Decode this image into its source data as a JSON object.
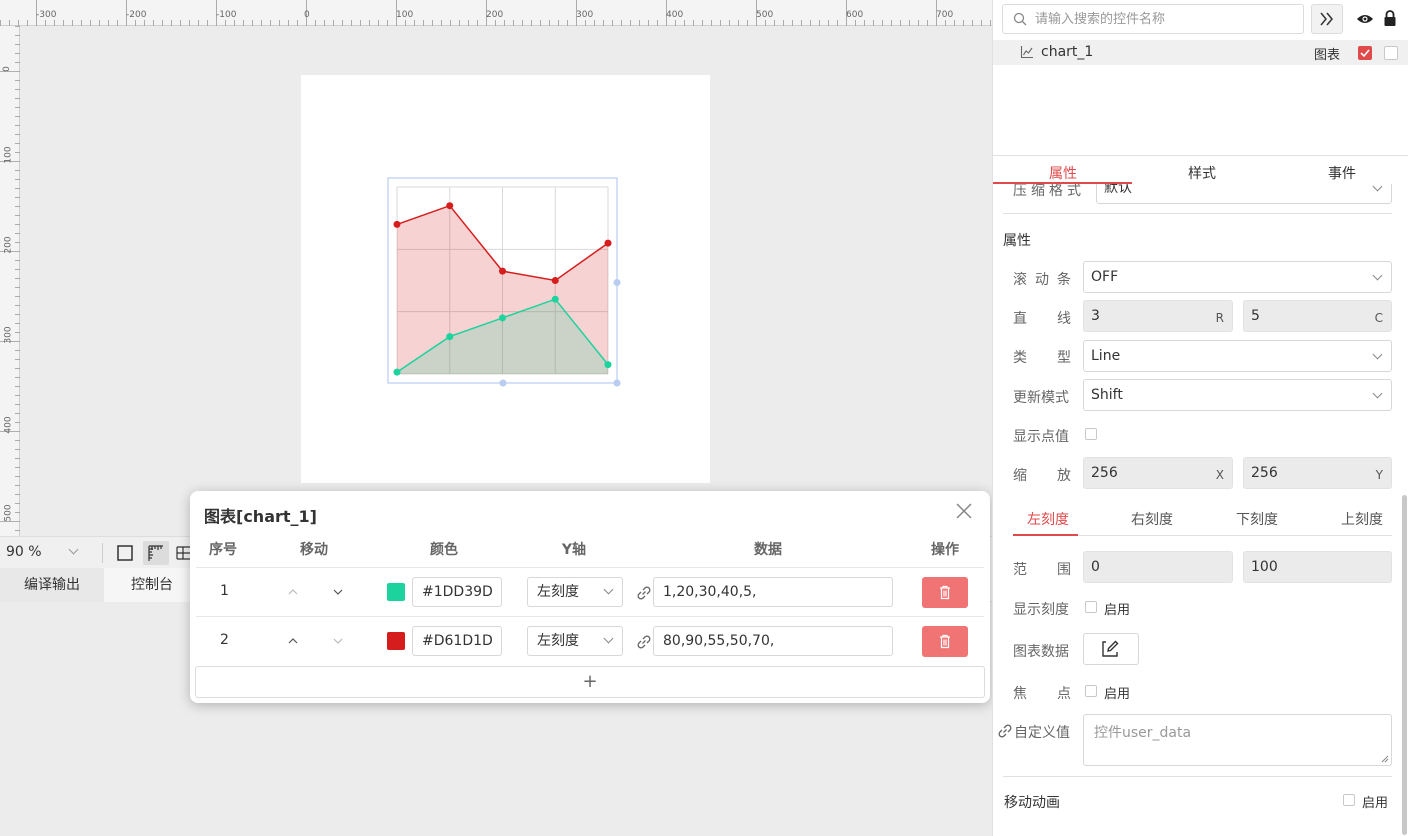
{
  "ruler": {
    "top_labels": [
      "-300",
      "-200",
      "-100",
      "0",
      "100",
      "200",
      "300",
      "400",
      "500",
      "600",
      "700"
    ],
    "left_labels": [
      "0",
      "100",
      "200",
      "300",
      "400",
      "500"
    ]
  },
  "chart_data": {
    "type": "area",
    "x": [
      1,
      2,
      3,
      4,
      5
    ],
    "series": [
      {
        "name": "",
        "color": "#1DD39D",
        "values": [
          1,
          20,
          30,
          40,
          5
        ]
      },
      {
        "name": "",
        "color": "#D61D1D",
        "values": [
          80,
          90,
          55,
          50,
          70
        ]
      }
    ],
    "ylim": [
      0,
      100
    ],
    "grid_rows": 3,
    "grid_cols": 5
  },
  "toolbar": {
    "zoom": "90 %"
  },
  "output_tabs": {
    "compile": "编译输出",
    "console": "控制台"
  },
  "dialog": {
    "title": "图表[chart_1]",
    "headers": {
      "index": "序号",
      "move": "移动",
      "color": "颜色",
      "yaxis": "Y轴",
      "data": "数据",
      "ops": "操作"
    },
    "rows": [
      {
        "index": "1",
        "color": "#1DD39D",
        "color_text": "#1DD39D",
        "yaxis": "左刻度",
        "data": "1,20,30,40,5,"
      },
      {
        "index": "2",
        "color": "#D61D1D",
        "color_text": "#D61D1D",
        "yaxis": "左刻度",
        "data": "80,90,55,50,70,"
      }
    ],
    "add_symbol": "+"
  },
  "panel": {
    "search_placeholder": "请输入搜索的控件名称",
    "tree": {
      "name": "chart_1",
      "type": "图表"
    },
    "tabs": {
      "props": "属性",
      "style": "样式",
      "events": "事件"
    },
    "compress": {
      "label": "压缩格式",
      "value": "默认"
    },
    "section_title": "属性",
    "scrollbar": {
      "label": "滚动条",
      "value": "OFF"
    },
    "lines": {
      "label": "直线",
      "r_value": "3",
      "r_suffix": "R",
      "c_value": "5",
      "c_suffix": "C"
    },
    "type": {
      "label": "类型",
      "value": "Line"
    },
    "update_mode": {
      "label": "更新模式",
      "value": "Shift"
    },
    "show_points": {
      "label": "显示点值"
    },
    "zoom": {
      "label": "缩放",
      "x_value": "256",
      "x_suffix": "X",
      "y_value": "256",
      "y_suffix": "Y"
    },
    "scale_tabs": {
      "left": "左刻度",
      "right": "右刻度",
      "bottom": "下刻度",
      "top": "上刻度"
    },
    "range": {
      "label": "范围",
      "min": "0",
      "max": "100"
    },
    "show_scale": {
      "label": "显示刻度",
      "enable": "启用"
    },
    "chart_data_label": "图表数据",
    "focus": {
      "label": "焦点",
      "enable": "启用"
    },
    "custom": {
      "label": "自定义值",
      "placeholder": "控件user_data"
    },
    "anim": {
      "label": "移动动画",
      "enable": "启用"
    }
  }
}
